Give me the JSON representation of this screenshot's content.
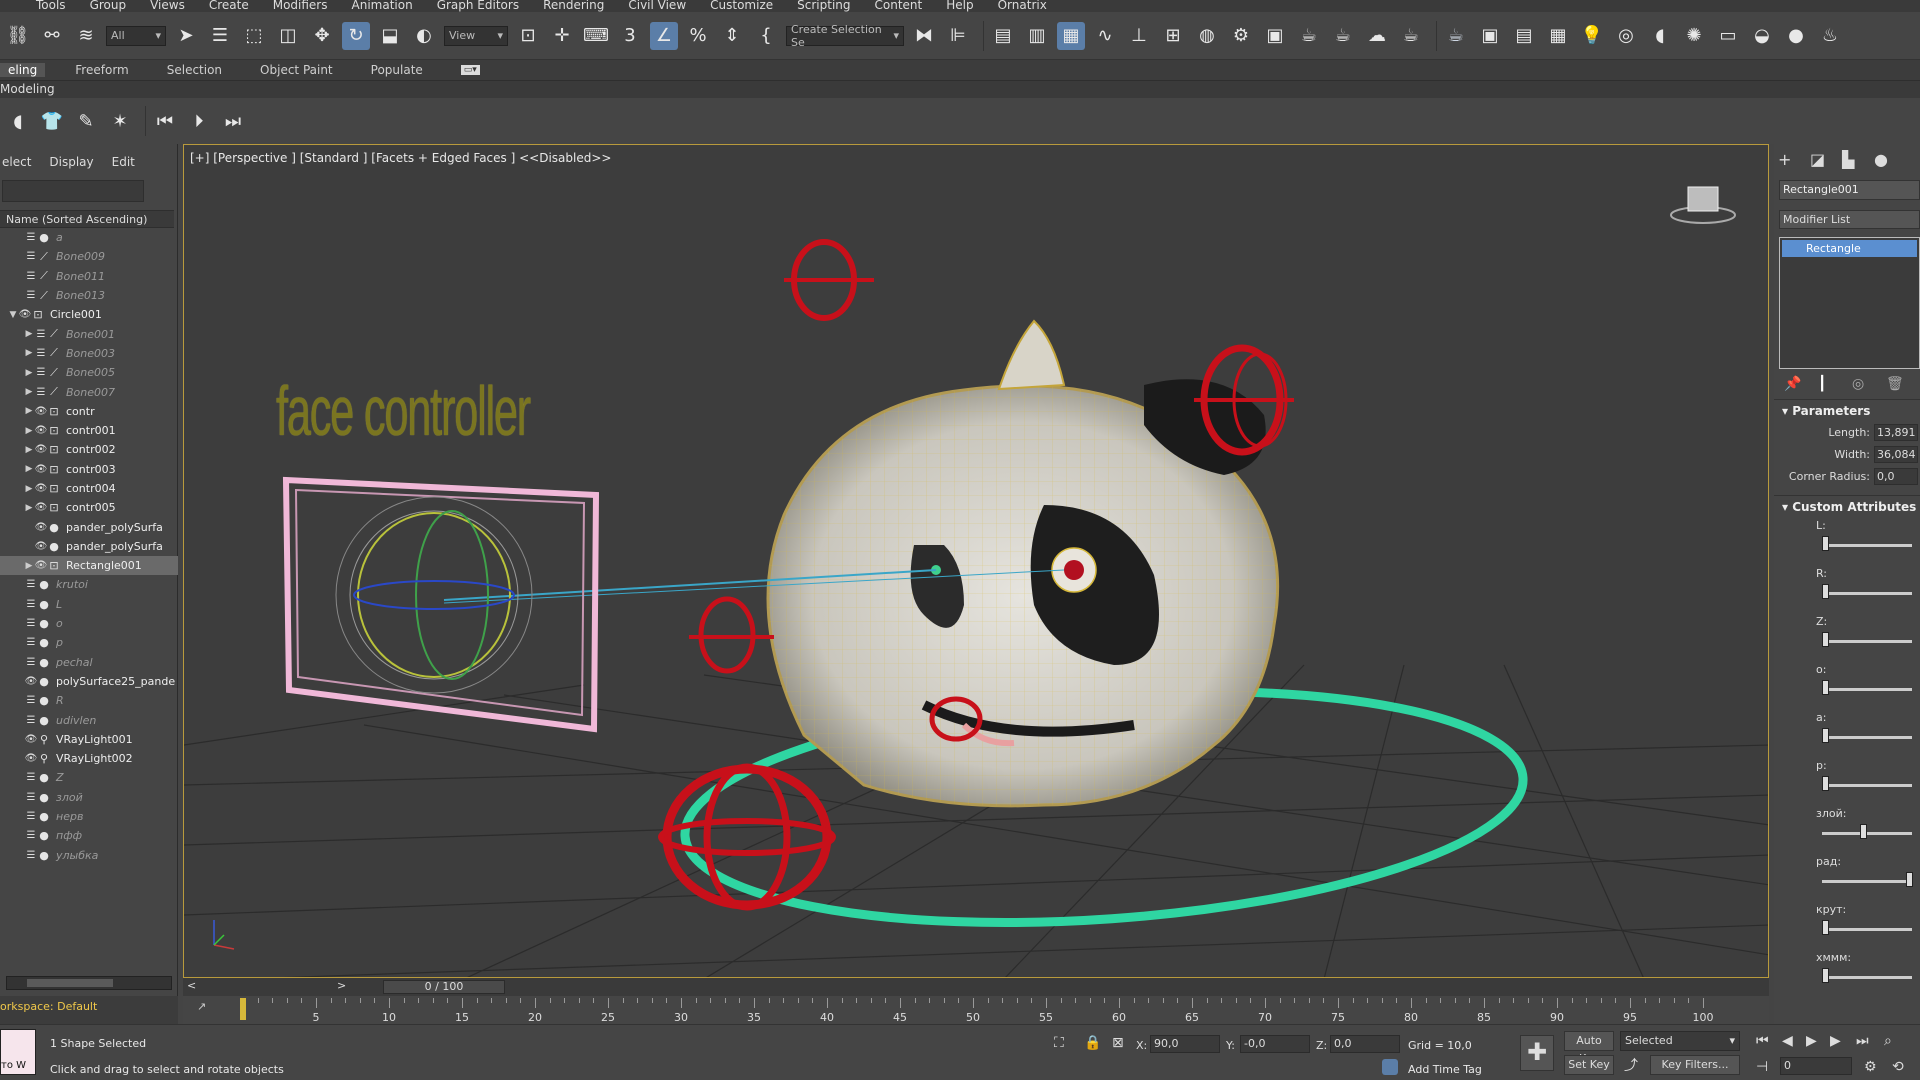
{
  "menu": [
    "Tools",
    "Group",
    "Views",
    "Create",
    "Modifiers",
    "Animation",
    "Graph Editors",
    "Rendering",
    "Civil View",
    "Customize",
    "Scripting",
    "Content",
    "Help",
    "Ornatrix"
  ],
  "toolbar": {
    "filter_value": "All",
    "view_value": "View",
    "selection_set": "Create Selection Se",
    "icons": [
      "link-icon",
      "unlink-icon",
      "bind-icon",
      "select-icon",
      "select-by-name-icon",
      "rect-region-icon",
      "window-crossing-icon",
      "move-icon",
      "rotate-icon",
      "scale-icon",
      "select-place-icon",
      "pivot-icon",
      "select-manipulate-icon",
      "keyboard-shortcut-icon",
      "snap-3d-icon",
      "angle-snap-icon",
      "percent-snap-icon",
      "spinner-snap-icon",
      "edit-named-sets-icon",
      "mirror-icon",
      "align-icon",
      "layer-manager-icon",
      "scene-explorer-icon",
      "ribbon-icon",
      "curve-editor-icon",
      "schematic-icon",
      "material-editor-icon",
      "render-setup-icon",
      "rendered-frame-icon",
      "render-icon",
      "teapot-icon"
    ]
  },
  "ribbon": {
    "tabs": [
      "eling",
      "Freeform",
      "Selection",
      "Object Paint",
      "Populate"
    ],
    "sub": "Modeling"
  },
  "scene_explorer": {
    "tabs": [
      "elect",
      "Display",
      "Edit"
    ],
    "column_header": "Name (Sorted Ascending)",
    "rows": [
      {
        "label": "a",
        "hidden": true,
        "type": "dot"
      },
      {
        "label": "Bone009",
        "hidden": true,
        "type": "bone"
      },
      {
        "label": "Bone011",
        "hidden": true,
        "type": "bone"
      },
      {
        "label": "Bone013",
        "hidden": true,
        "type": "bone"
      },
      {
        "label": "Circle001",
        "hidden": false,
        "type": "shape",
        "expanded": true
      },
      {
        "label": "Bone001",
        "hidden": true,
        "type": "bone",
        "child": true
      },
      {
        "label": "Bone003",
        "hidden": true,
        "type": "bone",
        "child": true
      },
      {
        "label": "Bone005",
        "hidden": true,
        "type": "bone",
        "child": true
      },
      {
        "label": "Bone007",
        "hidden": true,
        "type": "bone",
        "child": true
      },
      {
        "label": "contr",
        "hidden": false,
        "type": "shape",
        "child": true
      },
      {
        "label": "contr001",
        "hidden": false,
        "type": "shape",
        "child": true
      },
      {
        "label": "contr002",
        "hidden": false,
        "type": "shape",
        "child": true
      },
      {
        "label": "contr003",
        "hidden": false,
        "type": "shape",
        "child": true
      },
      {
        "label": "contr004",
        "hidden": false,
        "type": "shape",
        "child": true
      },
      {
        "label": "contr005",
        "hidden": false,
        "type": "shape",
        "child": true
      },
      {
        "label": "pander_polySurfa",
        "hidden": false,
        "type": "dot",
        "child": true,
        "noarrow": true
      },
      {
        "label": "pander_polySurfa",
        "hidden": false,
        "type": "dot",
        "child": true,
        "noarrow": true
      },
      {
        "label": "Rectangle001",
        "hidden": false,
        "type": "shape",
        "child": true,
        "selected": true
      },
      {
        "label": "krutoi",
        "hidden": true,
        "type": "dot"
      },
      {
        "label": "L",
        "hidden": true,
        "type": "dot"
      },
      {
        "label": "o",
        "hidden": true,
        "type": "dot"
      },
      {
        "label": "p",
        "hidden": true,
        "type": "dot"
      },
      {
        "label": "pechal",
        "hidden": true,
        "type": "dot"
      },
      {
        "label": "polySurface25_pande",
        "hidden": false,
        "type": "dot"
      },
      {
        "label": "R",
        "hidden": true,
        "type": "dot"
      },
      {
        "label": "udivlen",
        "hidden": true,
        "type": "dot"
      },
      {
        "label": "VRayLight001",
        "hidden": false,
        "type": "light"
      },
      {
        "label": "VRayLight002",
        "hidden": false,
        "type": "light"
      },
      {
        "label": "Z",
        "hidden": true,
        "type": "dot"
      },
      {
        "label": "злой",
        "hidden": true,
        "type": "dot"
      },
      {
        "label": "нерв",
        "hidden": true,
        "type": "dot"
      },
      {
        "label": "пфф",
        "hidden": true,
        "type": "dot"
      },
      {
        "label": "улыбка",
        "hidden": true,
        "type": "dot"
      }
    ],
    "workspace": "orkspace: Default"
  },
  "viewport": {
    "label": "[+] [Perspective ] [Standard ] [Facets + Edged Faces ]  <<Disabled>>",
    "face_text": "face controller",
    "colors": {
      "controller": "#c8101a",
      "ring": "#2fd6a2",
      "frame": "#f0b8d8",
      "wire": "#d6b83a"
    }
  },
  "command_panel": {
    "object_name": "Rectangle001",
    "modifier_list": "Modifier List",
    "stack_item": "Rectangle",
    "parameters_title": "Parameters",
    "params": [
      {
        "label": "Length:",
        "value": "13,891"
      },
      {
        "label": "Width:",
        "value": "36,084"
      },
      {
        "label": "Corner Radius:",
        "value": "0,0"
      }
    ],
    "custom_title": "Custom Attributes",
    "custom": [
      {
        "label": "L:",
        "value": 0.0
      },
      {
        "label": "R:",
        "value": 0.0
      },
      {
        "label": "Z:",
        "value": 0.0
      },
      {
        "label": "o:",
        "value": 0.0
      },
      {
        "label": "a:",
        "value": 0.0
      },
      {
        "label": "p:",
        "value": 0.0
      },
      {
        "label": "злой:",
        "value": 0.45
      },
      {
        "label": "рад:",
        "value": 1.0
      },
      {
        "label": "крут:",
        "value": 0.0
      },
      {
        "label": "хммм:",
        "value": 0.0
      }
    ]
  },
  "timeline": {
    "frame": "0 / 100",
    "ticks": [
      "5",
      "10",
      "15",
      "20",
      "25",
      "30",
      "35",
      "40",
      "45",
      "50",
      "55",
      "60",
      "65",
      "70",
      "75",
      "80",
      "85",
      "90",
      "95",
      "100"
    ]
  },
  "status": {
    "selected": "1 Shape Selected",
    "prompt": "Click and drag to select and rotate objects",
    "x_value": "90,0",
    "y_value": "-0,0",
    "z_value": "0,0",
    "grid": "Grid = 10,0",
    "auto_key": "Auto Key",
    "set_key": "Set Key",
    "selected_dd": "Selected",
    "key_filters": "Key Filters...",
    "add_time_tag": "Add Time Tag",
    "frame_field": "0",
    "mini_listener": "то W"
  }
}
